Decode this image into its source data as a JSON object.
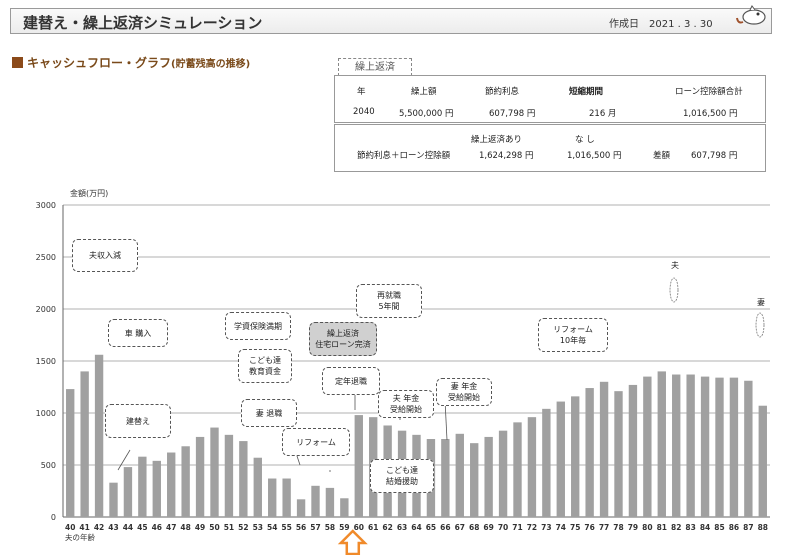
{
  "header": {
    "title": "建替え・繰上返済シミュレーション",
    "date_label": "作成日",
    "date_value": "2021 . 3 . 30"
  },
  "section": {
    "title": "キャッシュフロー・グラフ",
    "subtitle": "(貯蓄残高の推移)"
  },
  "panel": {
    "tab": "繰上返済",
    "headers": [
      "年",
      "繰上額",
      "節約利息",
      "短縮期間",
      "ローン控除額合計"
    ],
    "row": [
      "2040",
      "5,500,000 円",
      "607,798 円",
      "216 月",
      "1,016,500 円"
    ],
    "compare_header_yes": "繰上返済あり",
    "compare_header_no": "な し",
    "compare_label": "節約利息＋ローン控除額",
    "compare_yes": "1,624,298 円",
    "compare_no": "1,016,500 円",
    "diff_label": "差額",
    "diff_value": "607,798 円"
  },
  "chart_data": {
    "type": "bar",
    "ylabel": "金額(万円)",
    "xlabel": "夫の年齢",
    "ylim": [
      0,
      3000
    ],
    "yticks": [
      0,
      500,
      1000,
      1500,
      2000,
      2500,
      3000
    ],
    "grid": true,
    "bar_color": "#a0a0a0",
    "categories": [
      "40",
      "41",
      "42",
      "43",
      "44",
      "45",
      "46",
      "47",
      "48",
      "49",
      "50",
      "51",
      "52",
      "53",
      "54",
      "55",
      "56",
      "57",
      "58",
      "59",
      "60",
      "61",
      "62",
      "63",
      "64",
      "65",
      "66",
      "67",
      "68",
      "69",
      "70",
      "71",
      "72",
      "73",
      "74",
      "75",
      "76",
      "77",
      "78",
      "79",
      "80",
      "81",
      "82",
      "83",
      "84",
      "85",
      "86",
      "87",
      "88"
    ],
    "values": [
      1230,
      1400,
      1560,
      330,
      480,
      580,
      540,
      620,
      680,
      770,
      860,
      790,
      730,
      570,
      370,
      370,
      170,
      300,
      280,
      180,
      980,
      960,
      880,
      830,
      790,
      750,
      750,
      800,
      710,
      770,
      830,
      910,
      960,
      1040,
      1110,
      1160,
      1240,
      1300,
      1210,
      1270,
      1350,
      1400,
      1370,
      1370,
      1350,
      1340,
      1340,
      1310,
      1070
    ],
    "highlight_arrow_category": "60",
    "annotations": [
      {
        "text": "夫収入減",
        "category": "41"
      },
      {
        "text": "車 購入",
        "category": "43"
      },
      {
        "text": "建替え",
        "category": "43"
      },
      {
        "text": "学資保険満期",
        "category": "50"
      },
      {
        "text": "こども達\n教育資金",
        "category": "50"
      },
      {
        "text": "妻 退職",
        "category": "53"
      },
      {
        "text": "リフォーム",
        "category": "56"
      },
      {
        "text": "繰上返済\n住宅ローン完済",
        "category": "59"
      },
      {
        "text": "再就職\n5年間",
        "category": "60"
      },
      {
        "text": "定年退職",
        "category": "60"
      },
      {
        "text": "夫 年金\n受給開始",
        "category": "65"
      },
      {
        "text": "妻 年金\n受給開始",
        "category": "66"
      },
      {
        "text": "こども達\n結婚援助",
        "category": "63"
      },
      {
        "text": "リフォーム\n10年毎",
        "category": "75"
      },
      {
        "text": "夫",
        "category": "82"
      },
      {
        "text": "妻",
        "category": "88"
      }
    ]
  }
}
